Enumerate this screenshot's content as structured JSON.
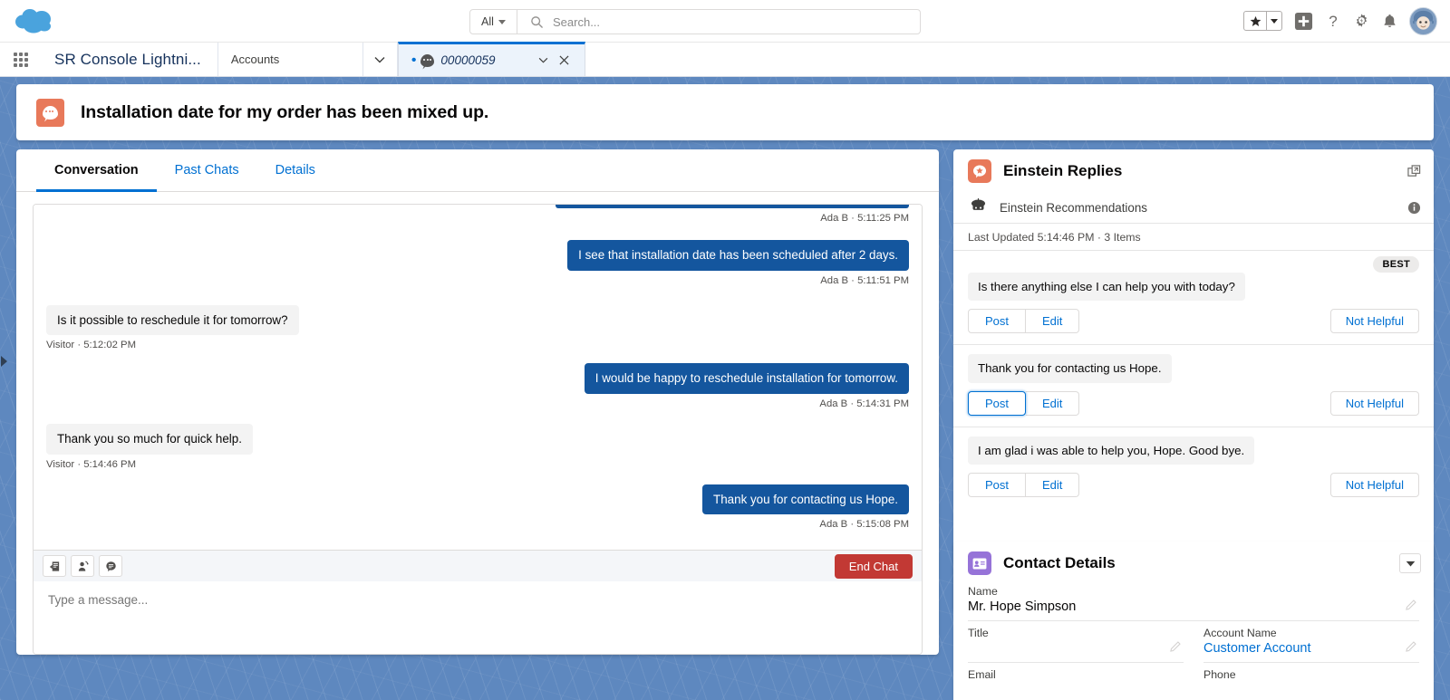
{
  "global_header": {
    "logo_name": "salesforce-cloud-logo",
    "search": {
      "scope": "All",
      "placeholder": "Search...",
      "value": ""
    },
    "actions": [
      {
        "name": "favorites-star-button",
        "icon": "star-icon"
      },
      {
        "name": "favorites-dropdown-button",
        "icon": "chevron-down-icon"
      },
      {
        "name": "global-actions-button",
        "icon": "plus-icon"
      },
      {
        "name": "help-button",
        "icon": "question-mark-icon"
      },
      {
        "name": "setup-button",
        "icon": "gear-icon"
      },
      {
        "name": "notifications-button",
        "icon": "bell-icon"
      },
      {
        "name": "user-avatar",
        "icon": "avatar-icon"
      }
    ]
  },
  "console": {
    "app_launcher_icon": "app-launcher-waffle-icon",
    "app_name": "SR Console Lightni...",
    "nav_tab": "Accounts",
    "nav_dropdown_icon": "chevron-down-icon",
    "active_tab": {
      "label": "00000059",
      "unsaved_marker": "•",
      "icon": "chat-icon",
      "menu_icon": "chevron-down-icon",
      "close_icon": "close-icon"
    }
  },
  "highlight_panel": {
    "icon": "live-chat-icon",
    "title": "Installation date for my order has been mixed up."
  },
  "conversation": {
    "tabs": [
      {
        "label": "Conversation",
        "active": true
      },
      {
        "label": "Past Chats",
        "active": false
      },
      {
        "label": "Details",
        "active": false
      }
    ],
    "messages": [
      {
        "direction": "out",
        "text": "",
        "meta": "Ada B · 5:11:25 PM",
        "clipped": true
      },
      {
        "direction": "out",
        "text": "I see that installation date has been scheduled after 2 days.",
        "meta": "Ada B · 5:11:51 PM"
      },
      {
        "direction": "in",
        "text": "Is it possible to reschedule it for tomorrow?",
        "meta": "Visitor · 5:12:02 PM"
      },
      {
        "direction": "out",
        "text": "I would be happy to reschedule installation for tomorrow.",
        "meta": "Ada B · 5:14:31 PM"
      },
      {
        "direction": "in",
        "text": "Thank you so much for quick help.",
        "meta": "Visitor · 5:14:46 PM"
      },
      {
        "direction": "out",
        "text": "Thank you for contacting us Hope.",
        "meta": "Ada B · 5:15:08 PM"
      }
    ],
    "composer": {
      "tools": [
        {
          "name": "knowledge-article-icon"
        },
        {
          "name": "transfer-chat-icon"
        },
        {
          "name": "quick-text-icon"
        }
      ],
      "end_chat_label": "End Chat",
      "placeholder": "Type a message...",
      "value": ""
    }
  },
  "einstein_panel": {
    "icon": "einstein-replies-icon",
    "title": "Einstein Replies",
    "popout_icon": "pop-out-icon",
    "section_icon": "einstein-icon",
    "section_label": "Einstein Recommendations",
    "info_icon": "info-icon",
    "last_updated": "Last Updated 5:14:46 PM · 3 Items",
    "recommendations": [
      {
        "text": "Is there anything else I can help you with today?",
        "badge": "BEST",
        "post_label": "Post",
        "edit_label": "Edit",
        "not_helpful_label": "Not Helpful",
        "post_focused": false
      },
      {
        "text": "Thank you for contacting us Hope.",
        "badge": "",
        "post_label": "Post",
        "edit_label": "Edit",
        "not_helpful_label": "Not Helpful",
        "post_focused": true
      },
      {
        "text": "I am glad i was able to help you, Hope. Good bye.",
        "badge": "",
        "post_label": "Post",
        "edit_label": "Edit",
        "not_helpful_label": "Not Helpful",
        "post_focused": false
      }
    ]
  },
  "contact_details": {
    "icon": "contact-card-icon",
    "title": "Contact Details",
    "collapse_icon": "chevron-down-icon",
    "fields": {
      "name_label": "Name",
      "name_value": "Mr. Hope Simpson",
      "title_label": "Title",
      "title_value": "",
      "account_label": "Account Name",
      "account_value": "Customer Account",
      "email_label": "Email",
      "phone_label": "Phone"
    }
  },
  "colors": {
    "brand_blue": "#0070d2",
    "bubble_agent": "#14569e",
    "bubble_visitor": "#f3f3f3",
    "end_chat_red": "#c23934",
    "einstein_orange": "#e8795a",
    "contact_purple": "#9673d8",
    "workspace_bg": "#5e88bf"
  }
}
